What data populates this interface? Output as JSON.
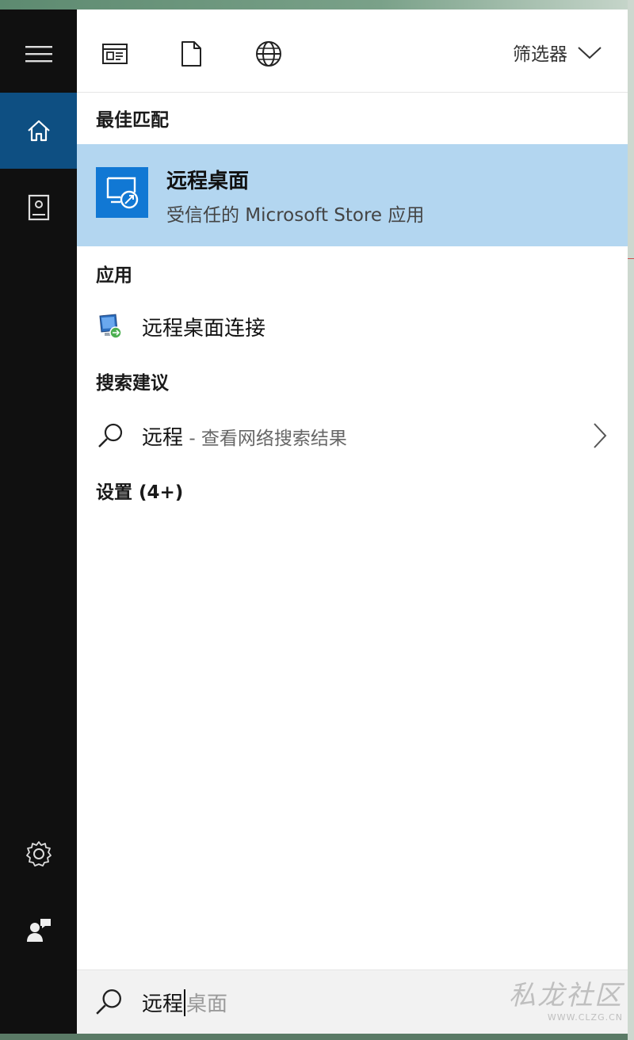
{
  "toolbar": {
    "filter_label": "筛选器",
    "icons": [
      "apps-scope-icon",
      "documents-scope-icon",
      "web-scope-icon"
    ]
  },
  "best_match": {
    "header": "最佳匹配",
    "title": "远程桌面",
    "subtitle": "受信任的 Microsoft Store 应用",
    "tile_color": "#1178d4",
    "highlight_color": "#b3d6f0"
  },
  "apps": {
    "header": "应用",
    "items": [
      {
        "label": "远程桌面连接"
      }
    ]
  },
  "suggestions": {
    "header": "搜索建议",
    "items": [
      {
        "query": "远程",
        "hint": " - 查看网络搜索结果"
      }
    ]
  },
  "settings": {
    "header": "设置 (4+)"
  },
  "search": {
    "typed": "远程",
    "autocomplete": "桌面"
  },
  "watermark": {
    "text": "私龙社区",
    "small": "WWW.CLZG.CN"
  },
  "colors": {
    "rail": "#101010",
    "rail_active": "#0e4f82"
  }
}
